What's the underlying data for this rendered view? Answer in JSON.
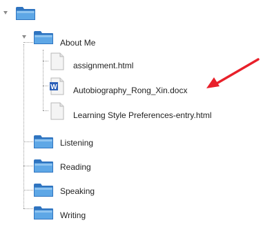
{
  "tree": {
    "root": {
      "expanded": true,
      "icon": "folder-icon"
    },
    "about_me": {
      "label": "About Me",
      "expanded": true,
      "icon": "folder-icon"
    },
    "files": [
      {
        "label": "assignment.html",
        "icon": "document-icon"
      },
      {
        "label": "Autobiography_Rong_Xin.docx",
        "icon": "word-document-icon"
      },
      {
        "label": "Learning Style Preferences-entry.html",
        "icon": "document-icon"
      }
    ],
    "folders": [
      {
        "label": "Listening",
        "icon": "folder-icon"
      },
      {
        "label": "Reading",
        "icon": "folder-icon"
      },
      {
        "label": "Speaking",
        "icon": "folder-icon"
      },
      {
        "label": "Writing",
        "icon": "folder-icon"
      }
    ]
  },
  "annotation": {
    "color": "#e8202a",
    "icon": "red-arrow-icon"
  },
  "colors": {
    "folder_blue": "#5ea7e6",
    "folder_dark": "#2f74c0",
    "twisty": "#8c8c8c"
  }
}
